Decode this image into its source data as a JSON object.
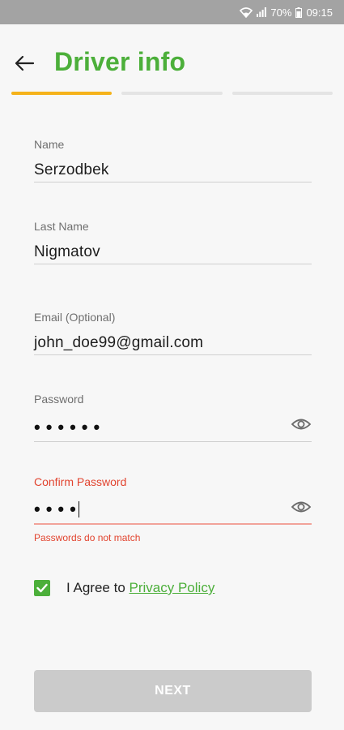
{
  "status_bar": {
    "battery": "70%",
    "time": "09:15",
    "icons": [
      "wifi-icon",
      "signal-icon",
      "battery-icon"
    ]
  },
  "header": {
    "back_icon": "arrow-left-icon",
    "title": "Driver info"
  },
  "progress": {
    "total_steps": 3,
    "current_step": 1,
    "active_color": "#f5b21a"
  },
  "form": {
    "name": {
      "label": "Name",
      "value": "Serzodbek"
    },
    "last_name": {
      "label": "Last Name",
      "value": "Nigmatov"
    },
    "email": {
      "label": "Email (Optional)",
      "value": "john_doe99@gmail.com"
    },
    "password": {
      "label": "Password",
      "value": "••••••",
      "icon": "eye-icon"
    },
    "confirm_password": {
      "label": "Confirm Password",
      "value": "••••",
      "icon": "eye-icon",
      "error": "Passwords do not match"
    }
  },
  "agreement": {
    "checked": true,
    "text": "I Agree to",
    "link": "Privacy Policy"
  },
  "next_button": {
    "label": "NEXT"
  },
  "colors": {
    "brand_green": "#4caf3a",
    "error_red": "#e2442f",
    "disabled_button": "#cbcbcb"
  }
}
